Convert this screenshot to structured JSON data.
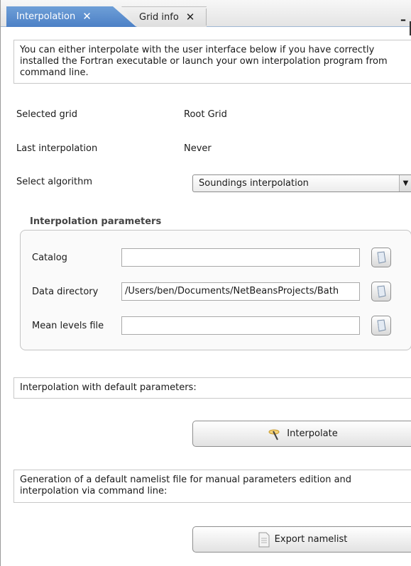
{
  "tabs": [
    {
      "label": "Interpolation",
      "active": true
    },
    {
      "label": "Grid info",
      "active": false
    }
  ],
  "window": {
    "minimize_glyph": "–"
  },
  "intro_text": "You can either interpolate with the user interface below if you have correctly installed the Fortran executable or launch your own interpolation program from command line.",
  "info": {
    "selected_grid_label": "Selected grid",
    "selected_grid_value": "Root Grid",
    "last_interpolation_label": "Last interpolation",
    "last_interpolation_value": "Never",
    "select_algorithm_label": "Select algorithm",
    "algorithm_selected": "Soundings interpolation"
  },
  "params": {
    "title": "Interpolation parameters",
    "catalog_label": "Catalog",
    "catalog_value": "",
    "data_directory_label": "Data directory",
    "data_directory_value": "/Users/ben/Documents/NetBeansProjects/Bath",
    "mean_levels_label": "Mean levels file",
    "mean_levels_value": ""
  },
  "default_section": {
    "text": "Interpolation with default parameters:",
    "button_label": "Interpolate"
  },
  "namelist_section": {
    "text": "Generation of a default namelist file for manual parameters edition and interpolation via command line:",
    "button_label": "Export namelist"
  },
  "icons": {
    "tab_close": "close-icon",
    "browse": "folder-icon",
    "interpolate": "magic-wand-icon",
    "export": "document-icon",
    "dropdown": "chevron-down-icon"
  }
}
